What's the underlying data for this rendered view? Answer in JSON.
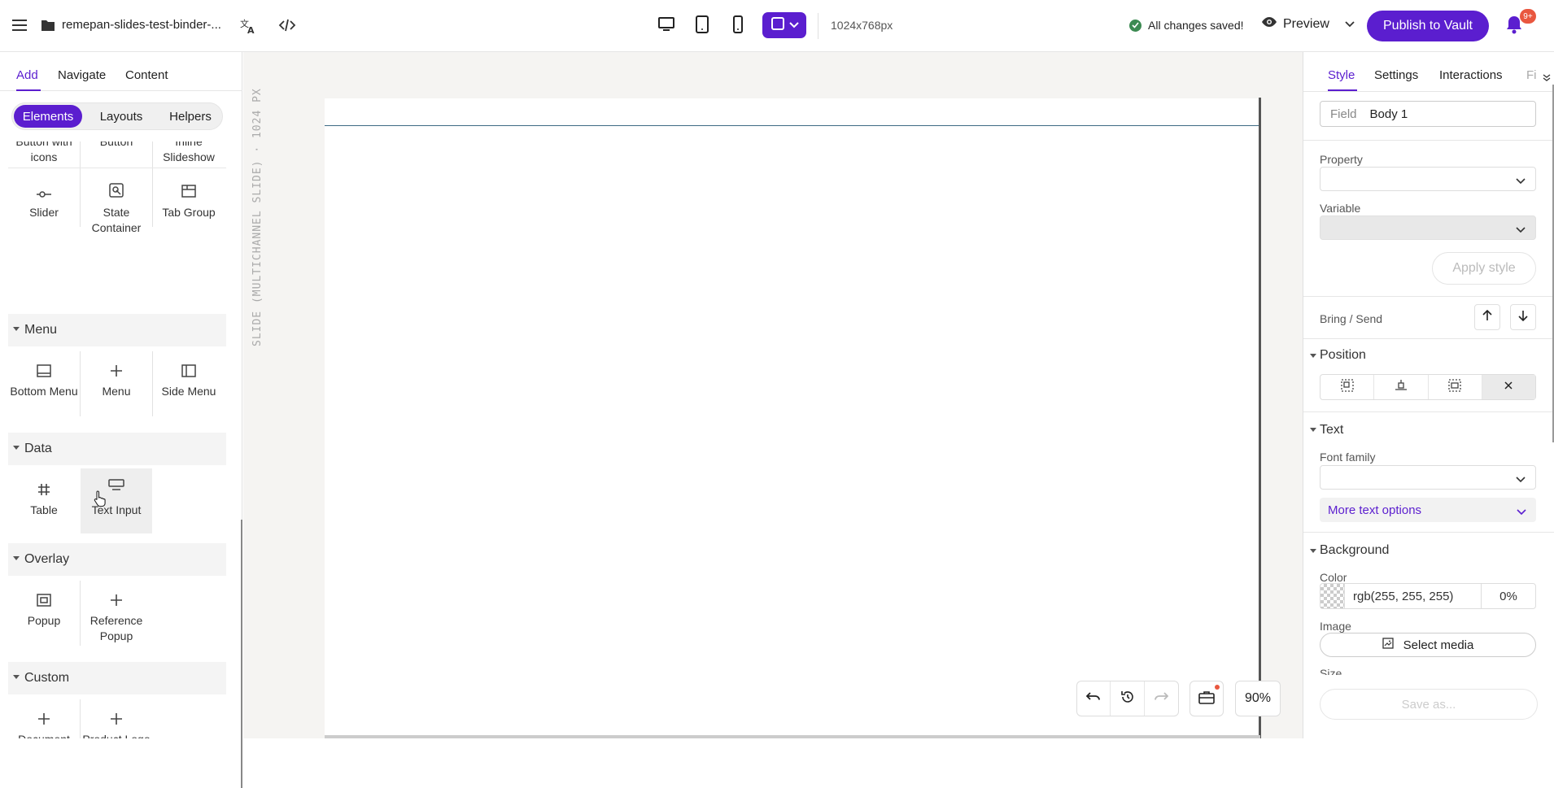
{
  "topbar": {
    "filename": "remepan-slides-test-binder-...",
    "dimensions": "1024x768px",
    "save_status": "All changes saved!",
    "preview_label": "Preview",
    "publish_label": "Publish to Vault",
    "notification_count": "9+",
    "accent_color": "#5b1ecf"
  },
  "left_panel": {
    "tabs": [
      "Add",
      "Navigate",
      "Content"
    ],
    "active_tab": "Add",
    "segments": [
      "Elements",
      "Layouts",
      "Helpers"
    ],
    "active_segment": "Elements",
    "partial_row": [
      "Button with icons",
      "Button",
      "Inline Slideshow"
    ],
    "row_controls": [
      "Slider",
      "State Container",
      "Tab Group"
    ],
    "sections": {
      "menu": {
        "title": "Menu",
        "items": [
          "Bottom Menu",
          "Menu",
          "Side Menu"
        ]
      },
      "data": {
        "title": "Data",
        "items": [
          "Table",
          "Text Input"
        ]
      },
      "overlay": {
        "title": "Overlay",
        "items": [
          "Popup",
          "Reference Popup"
        ]
      },
      "custom": {
        "title": "Custom",
        "items": [
          "Document Footer",
          "Product Logo"
        ]
      }
    }
  },
  "canvas": {
    "vertical_label": "SLIDE (MULTICHANNEL SLIDE) · 1024 PX",
    "zoom": "90%"
  },
  "right_panel": {
    "tabs": [
      "Style",
      "Settings",
      "Interactions",
      "Fi"
    ],
    "active_tab": "Style",
    "field_label": "Field",
    "field_value": "Body 1",
    "property_label": "Property",
    "variable_label": "Variable",
    "apply_style_label": "Apply style",
    "bring_send_label": "Bring / Send",
    "position_title": "Position",
    "text_title": "Text",
    "font_family_label": "Font family",
    "more_text_options": "More text options",
    "background_title": "Background",
    "color_label": "Color",
    "color_value": "rgb(255, 255, 255)",
    "opacity_value": "0%",
    "image_label": "Image",
    "select_media_label": "Select media",
    "size_label": "Size",
    "save_as_label": "Save as..."
  }
}
